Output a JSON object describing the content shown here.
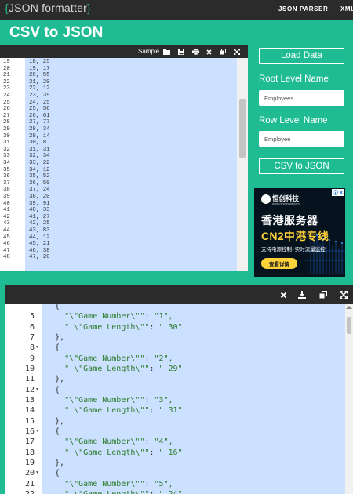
{
  "brand": {
    "logo": "JSON formatter"
  },
  "nav": {
    "parser": "JSON PARSER",
    "xml": "XML"
  },
  "page": {
    "title": "CSV to JSON"
  },
  "input_toolbar": {
    "sample": "Sample"
  },
  "input_editor": {
    "lines": [
      {
        "num": "19",
        "text": "18, 25"
      },
      {
        "num": "20",
        "text": "19, 17"
      },
      {
        "num": "21",
        "text": "20, 55"
      },
      {
        "num": "22",
        "text": "21, 20"
      },
      {
        "num": "23",
        "text": "22, 12"
      },
      {
        "num": "24",
        "text": "23, 39"
      },
      {
        "num": "25",
        "text": "24, 25"
      },
      {
        "num": "26",
        "text": "25, 56"
      },
      {
        "num": "27",
        "text": "26, 61"
      },
      {
        "num": "28",
        "text": "27, 77"
      },
      {
        "num": "29",
        "text": "28, 34"
      },
      {
        "num": "30",
        "text": "29, 14"
      },
      {
        "num": "31",
        "text": "30, 8"
      },
      {
        "num": "32",
        "text": "31, 31"
      },
      {
        "num": "33",
        "text": "32, 34"
      },
      {
        "num": "34",
        "text": "33, 22"
      },
      {
        "num": "35",
        "text": "34, 12"
      },
      {
        "num": "36",
        "text": "35, 52"
      },
      {
        "num": "37",
        "text": "36, 50"
      },
      {
        "num": "38",
        "text": "37, 24"
      },
      {
        "num": "39",
        "text": "38, 20"
      },
      {
        "num": "40",
        "text": "39, 91"
      },
      {
        "num": "41",
        "text": "40, 33"
      },
      {
        "num": "42",
        "text": "41, 27"
      },
      {
        "num": "43",
        "text": "42, 25"
      },
      {
        "num": "44",
        "text": "43, 83"
      },
      {
        "num": "45",
        "text": "44, 12"
      },
      {
        "num": "46",
        "text": "45, 21"
      },
      {
        "num": "47",
        "text": "46, 38"
      },
      {
        "num": "48",
        "text": "47, 20"
      }
    ]
  },
  "controls": {
    "load_data": "Load Data",
    "root_label": "Root Level Name",
    "root_value": "Employees",
    "row_label": "Row Level Name",
    "row_value": "Employee",
    "convert": "CSV to JSON"
  },
  "ad": {
    "close": "ⓘ ✕",
    "brand": "恒创科技",
    "brand_sub": "www.henghost.com",
    "headline1": "香港服务器",
    "headline2": "CN2中港专线",
    "headline3": "支持电源控制+实时流量监控",
    "cta": "查看详情"
  },
  "output_editor": {
    "lines": [
      {
        "num": "",
        "fold": false,
        "text": "  {",
        "kind": "punct"
      },
      {
        "num": "5",
        "fold": false,
        "kind": "kv",
        "key": "    \"\\\"Game Number\\\"\"",
        "value": "\"1\","
      },
      {
        "num": "6",
        "fold": false,
        "kind": "kv",
        "key": "    \" \\\"Game Length\\\"\"",
        "value": "\" 30\""
      },
      {
        "num": "7",
        "fold": false,
        "text": "  },",
        "kind": "punct"
      },
      {
        "num": "8",
        "fold": true,
        "text": "  {",
        "kind": "punct"
      },
      {
        "num": "9",
        "fold": false,
        "kind": "kv",
        "key": "    \"\\\"Game Number\\\"\"",
        "value": "\"2\","
      },
      {
        "num": "10",
        "fold": false,
        "kind": "kv",
        "key": "    \" \\\"Game Length\\\"\"",
        "value": "\" 29\""
      },
      {
        "num": "11",
        "fold": false,
        "text": "  },",
        "kind": "punct"
      },
      {
        "num": "12",
        "fold": true,
        "text": "  {",
        "kind": "punct"
      },
      {
        "num": "13",
        "fold": false,
        "kind": "kv",
        "key": "    \"\\\"Game Number\\\"\"",
        "value": "\"3\","
      },
      {
        "num": "14",
        "fold": false,
        "kind": "kv",
        "key": "    \" \\\"Game Length\\\"\"",
        "value": "\" 31\""
      },
      {
        "num": "15",
        "fold": false,
        "text": "  },",
        "kind": "punct"
      },
      {
        "num": "16",
        "fold": true,
        "text": "  {",
        "kind": "punct"
      },
      {
        "num": "17",
        "fold": false,
        "kind": "kv",
        "key": "    \"\\\"Game Number\\\"\"",
        "value": "\"4\","
      },
      {
        "num": "18",
        "fold": false,
        "kind": "kv",
        "key": "    \" \\\"Game Length\\\"\"",
        "value": "\" 16\""
      },
      {
        "num": "19",
        "fold": false,
        "text": "  },",
        "kind": "punct"
      },
      {
        "num": "20",
        "fold": true,
        "text": "  {",
        "kind": "punct"
      },
      {
        "num": "21",
        "fold": false,
        "kind": "kv",
        "key": "    \"\\\"Game Number\\\"\"",
        "value": "\"5\","
      },
      {
        "num": "22",
        "fold": false,
        "kind": "kv",
        "key": "    \" \\\"Game Length\\\"\"",
        "value": "\" 24\""
      }
    ]
  },
  "colors": {
    "accent": "#1fbc94",
    "toolbar": "#2b2b2b",
    "selection": "#cce0ff",
    "json_string": "#2d7d2d",
    "ad_yellow": "#ffd23a"
  },
  "icons": {
    "input_toolbar": [
      "folder-open-icon",
      "save-icon",
      "print-icon",
      "close-icon",
      "copy-icon",
      "fullscreen-icon"
    ],
    "output_toolbar": [
      "close-icon",
      "download-icon",
      "copy-icon",
      "fullscreen-icon"
    ]
  }
}
